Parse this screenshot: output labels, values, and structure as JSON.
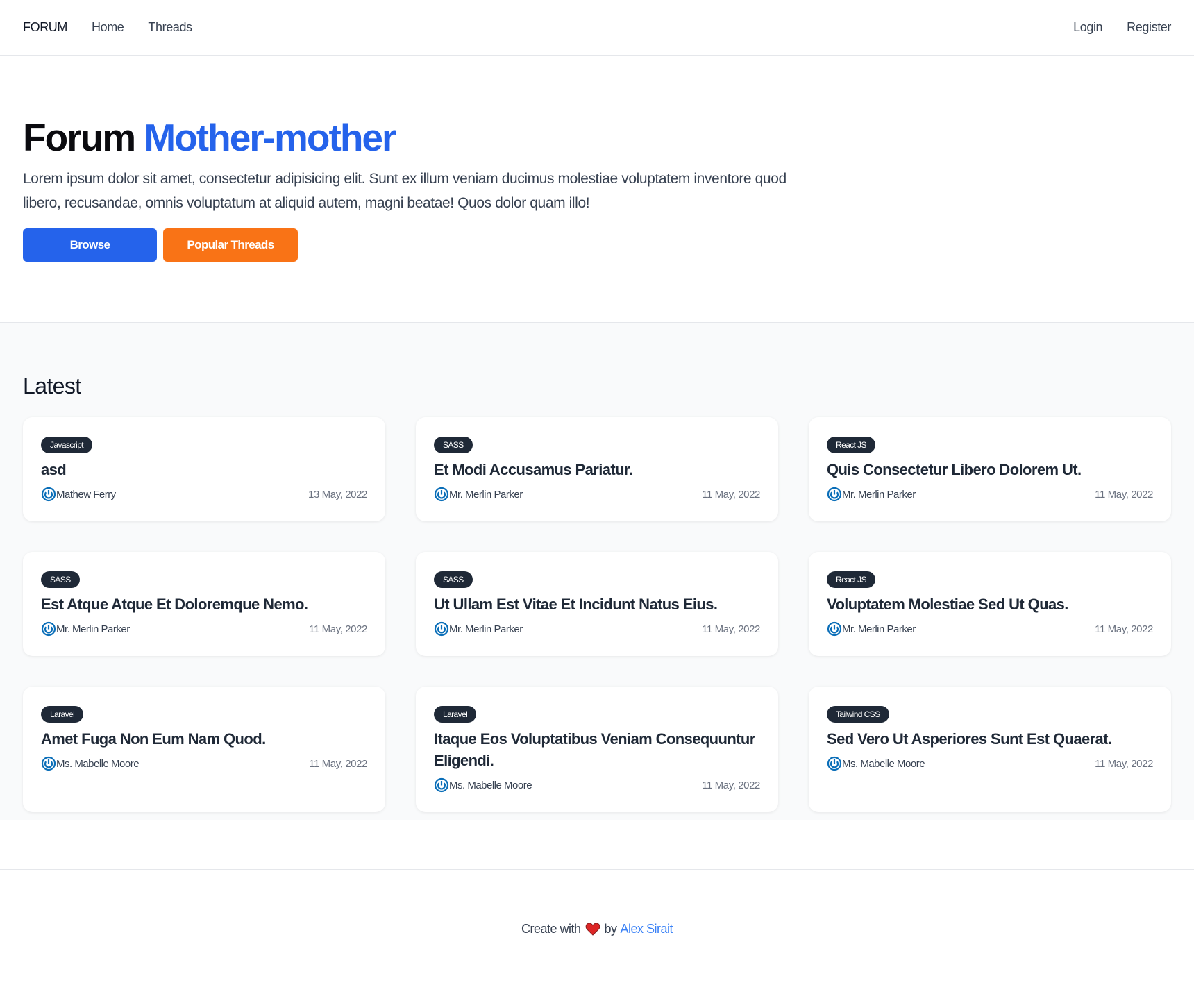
{
  "nav": {
    "brand": "FORUM",
    "links": [
      "Home",
      "Threads"
    ],
    "login": "Login",
    "register": "Register"
  },
  "hero": {
    "title_prefix": "Forum",
    "title_accent": "Mother-mother",
    "description": "Lorem ipsum dolor sit amet, consectetur adipisicing elit. Sunt ex illum veniam ducimus molestiae voluptatem inventore quod libero, recusandae, omnis voluptatum at aliquid autem, magni beatae! Quos dolor quam illo!",
    "browse_label": "Browse",
    "popular_label": "Popular Threads",
    "accent_color": "#2563eb",
    "popular_color": "#f97316"
  },
  "latest": {
    "title": "Latest",
    "threads": [
      {
        "tag": "Javascript",
        "title": "asd",
        "author": "Mathew Ferry",
        "date": "13 May, 2022"
      },
      {
        "tag": "SASS",
        "title": "Et Modi Accusamus Pariatur.",
        "author": "Mr. Merlin Parker",
        "date": "11 May, 2022"
      },
      {
        "tag": "React JS",
        "title": "Quis Consectetur Libero Dolorem Ut.",
        "author": "Mr. Merlin Parker",
        "date": "11 May, 2022"
      },
      {
        "tag": "SASS",
        "title": "Est Atque Atque Et Doloremque Nemo.",
        "author": "Mr. Merlin Parker",
        "date": "11 May, 2022"
      },
      {
        "tag": "SASS",
        "title": "Ut Ullam Est Vitae Et Incidunt Natus Eius.",
        "author": "Mr. Merlin Parker",
        "date": "11 May, 2022"
      },
      {
        "tag": "React JS",
        "title": "Voluptatem Molestiae Sed Ut Quas.",
        "author": "Mr. Merlin Parker",
        "date": "11 May, 2022"
      },
      {
        "tag": "Laravel",
        "title": "Amet Fuga Non Eum Nam Quod.",
        "author": "Ms. Mabelle Moore",
        "date": "11 May, 2022"
      },
      {
        "tag": "Laravel",
        "title": "Itaque Eos Voluptatibus Veniam Consequuntur Eligendi.",
        "author": "Ms. Mabelle Moore",
        "date": "11 May, 2022"
      },
      {
        "tag": "Tailwind CSS",
        "title": "Sed Vero Ut Asperiores Sunt Est Quaerat.",
        "author": "Ms. Mabelle Moore",
        "date": "11 May, 2022"
      }
    ]
  },
  "footer": {
    "prefix": "Create with",
    "by": "by",
    "author": "Alex Sirait",
    "heart_icon": "heart-icon",
    "heart_color": "#dc2626"
  }
}
